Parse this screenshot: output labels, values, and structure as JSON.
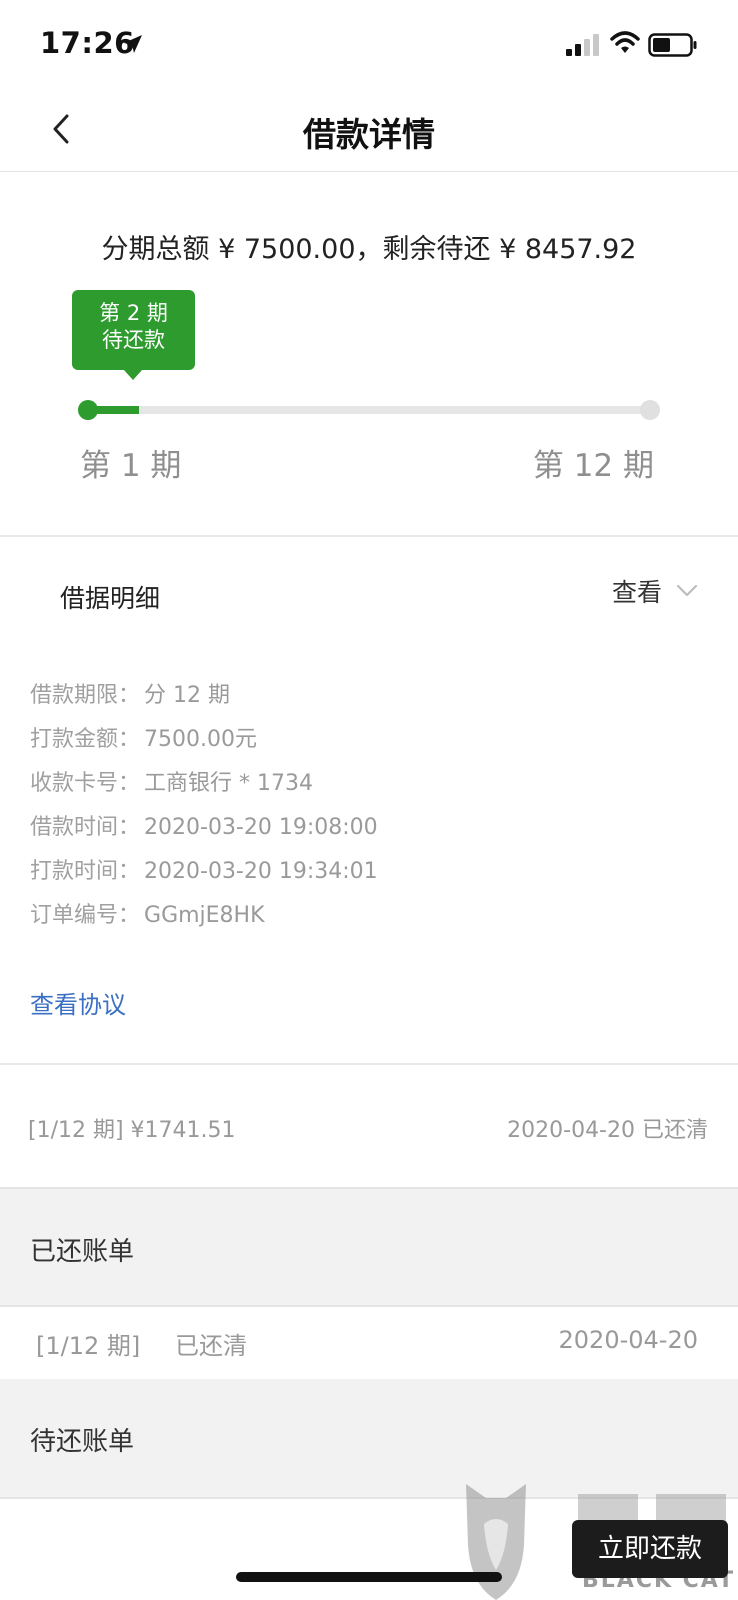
{
  "status_bar": {
    "time": "17:26"
  },
  "nav": {
    "title": "借款详情"
  },
  "progress": {
    "summary": "分期总额 ¥ 7500.00，剩余待还 ¥ 8457.92",
    "tooltip_period": "第 2 期",
    "tooltip_status": "待还款",
    "start_label": "第 1 期",
    "end_label": "第 12 期",
    "current_period": 2,
    "total_periods": 12,
    "accent_color": "#2e9b2f"
  },
  "details": {
    "title": "借据明细",
    "view_label": "查看",
    "rows": [
      {
        "key": "借款期限：",
        "value": "分 12 期"
      },
      {
        "key": "打款金额：",
        "value": "7500.00元"
      },
      {
        "key": "收款卡号：",
        "value": "工商银行 * 1734"
      },
      {
        "key": "借款时间：",
        "value": "2020-03-20 19:08:00"
      },
      {
        "key": "打款时间：",
        "value": "2020-03-20 19:34:01"
      },
      {
        "key": "订单编号：",
        "value": "GGmjE8HK"
      }
    ],
    "agreement_link": "查看协议"
  },
  "installment": {
    "left": "[1/12 期] ¥1741.51",
    "right": "2020-04-20 已还清"
  },
  "paid_bills": {
    "title": "已还账单",
    "rows": [
      {
        "period": "[1/12 期]",
        "status": "已还清",
        "date": "2020-04-20"
      }
    ]
  },
  "pending_bills": {
    "title": "待还账单"
  },
  "footer": {
    "repay_button": "立即还款",
    "watermark": "BLACK CAT"
  }
}
